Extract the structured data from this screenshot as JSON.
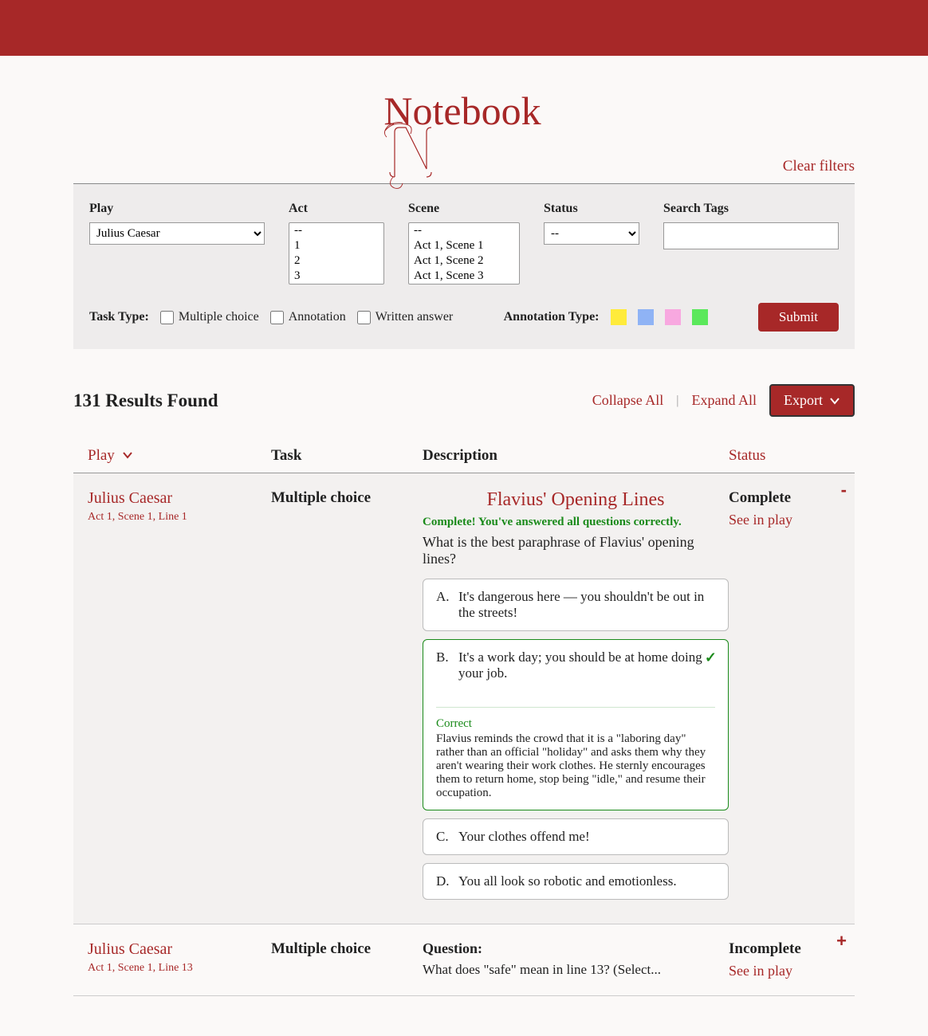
{
  "header": {
    "title": "Notebook"
  },
  "clear_filters_label": "Clear filters",
  "filters": {
    "play_label": "Play",
    "play_selected": "Julius Caesar",
    "act_label": "Act",
    "act_options": [
      "--",
      "1",
      "2",
      "3"
    ],
    "scene_label": "Scene",
    "scene_options": [
      "--",
      "Act 1, Scene 1",
      "Act 1, Scene 2",
      "Act 1, Scene 3"
    ],
    "status_label": "Status",
    "status_selected": "--",
    "tags_label": "Search Tags",
    "task_type_label": "Task Type:",
    "task_type_mc": "Multiple choice",
    "task_type_annot": "Annotation",
    "task_type_written": "Written answer",
    "annotation_type_label": "Annotation Type:",
    "submit_label": "Submit"
  },
  "results": {
    "count_text": "131 Results Found",
    "collapse_all": "Collapse All",
    "expand_all": "Expand All",
    "export_label": "Export"
  },
  "columns": {
    "play": "Play",
    "task": "Task",
    "description": "Description",
    "status": "Status"
  },
  "rows": [
    {
      "play_name": "Julius Caesar",
      "play_location": "Act 1, Scene 1, Line 1",
      "task": "Multiple choice",
      "status": "Complete",
      "see_in_play": "See in play",
      "toggle": "-",
      "mc": {
        "title": "Flavius' Opening Lines",
        "complete_msg": "Complete! You've answered all questions correctly.",
        "question": "What is the best paraphrase of Flavius' opening lines?",
        "options": [
          {
            "letter": "A.",
            "text": "It's dangerous here — you shouldn't be out in the streets!"
          },
          {
            "letter": "B.",
            "text": "It's a work day; you should be at home doing your job.",
            "correct": true,
            "correct_label": "Correct",
            "explanation": "Flavius reminds the crowd that it is a \"laboring day\" rather than an official \"holiday\" and asks them why they aren't wearing their work clothes. He sternly encourages them to return home, stop being \"idle,\" and resume their occupation."
          },
          {
            "letter": "C.",
            "text": "Your clothes offend me!"
          },
          {
            "letter": "D.",
            "text": "You all look so robotic and emotionless."
          }
        ]
      }
    },
    {
      "play_name": "Julius Caesar",
      "play_location": "Act 1, Scene 1, Line 13",
      "task": "Multiple choice",
      "status": "Incomplete",
      "see_in_play": "See in play",
      "toggle": "+",
      "question_label": "Question:",
      "question_preview": "What does \"safe\" mean in line 13? (Select..."
    }
  ]
}
